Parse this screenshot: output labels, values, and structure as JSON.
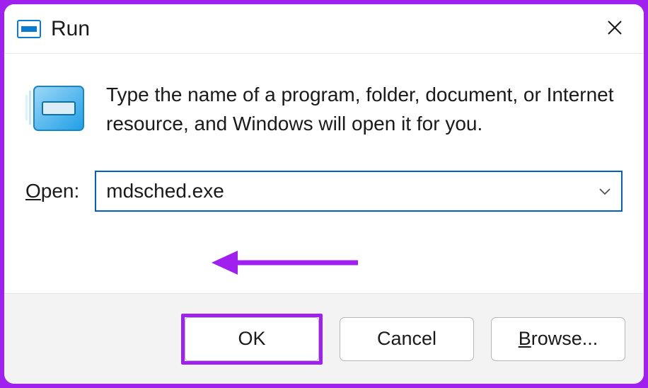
{
  "title": "Run",
  "description": "Type the name of a program, folder, document, or Internet resource, and Windows will open it for you.",
  "openLabel": {
    "prefix": "O",
    "rest": "pen:"
  },
  "inputValue": "mdsched.exe",
  "buttons": {
    "ok": "OK",
    "cancel": "Cancel",
    "browse": {
      "prefix": "B",
      "rest": "rowse..."
    }
  },
  "annotation": {
    "arrowColor": "#a020f0"
  }
}
